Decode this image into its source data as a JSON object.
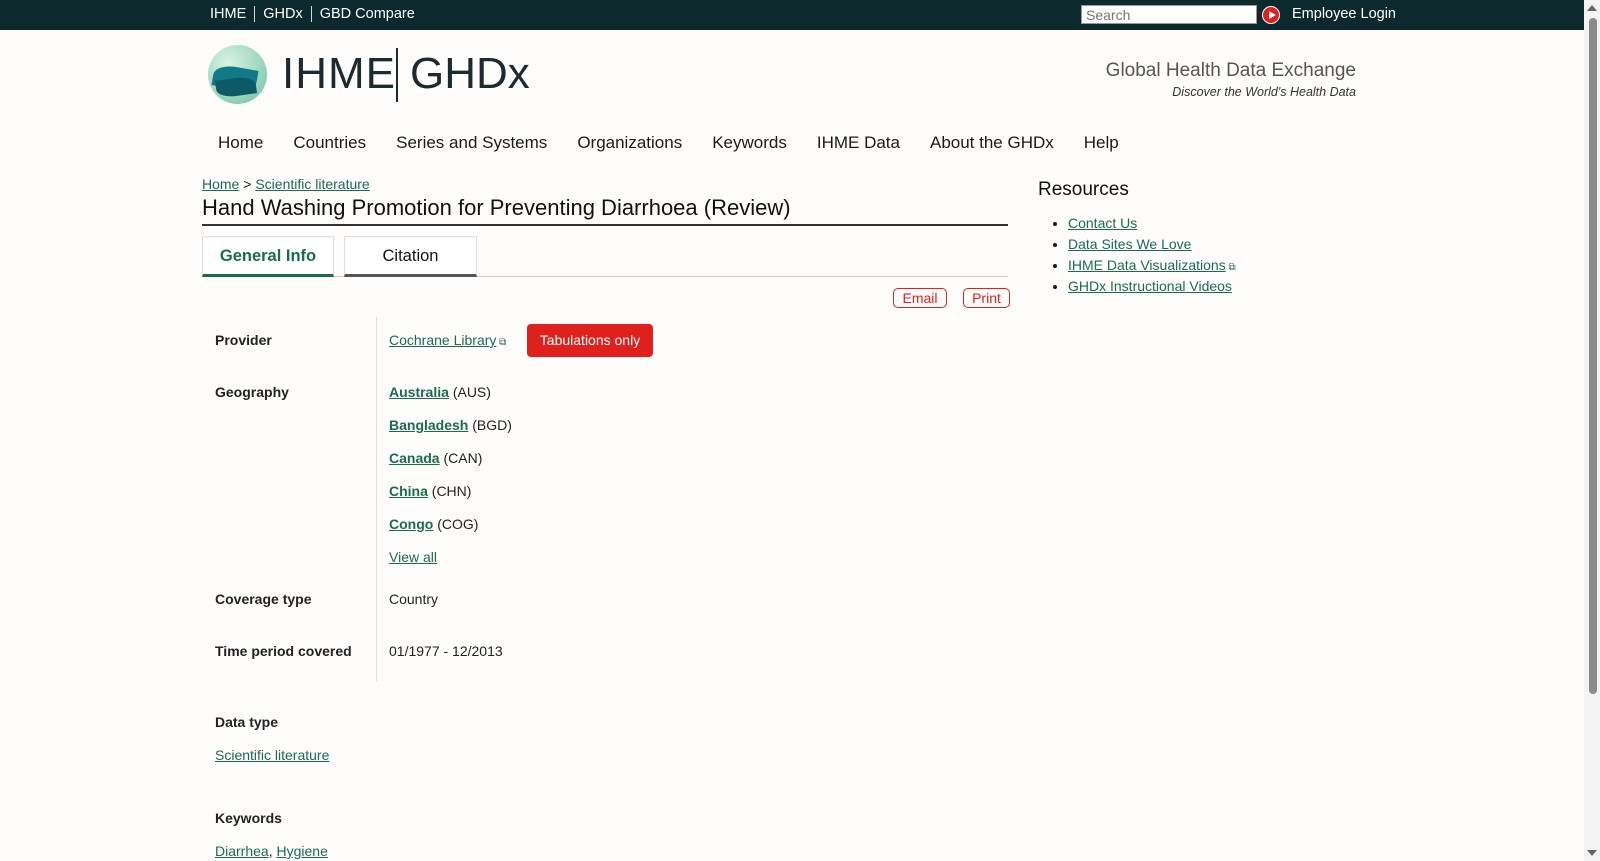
{
  "topbar": {
    "links": [
      "IHME",
      "GHDx",
      "GBD Compare"
    ],
    "search_placeholder": "Search",
    "login": "Employee Login"
  },
  "header": {
    "logo_left": "IHME",
    "logo_right": "GHDx",
    "tagline": "Global Health Data Exchange",
    "subtagline": "Discover the World's Health Data"
  },
  "nav": [
    "Home",
    "Countries",
    "Series and Systems",
    "Organizations",
    "Keywords",
    "IHME Data",
    "About the GHDx",
    "Help"
  ],
  "breadcrumb": {
    "home": "Home",
    "sep": ">",
    "current": "Scientific literature"
  },
  "page_title": "Hand Washing Promotion for Preventing Diarrhoea (Review)",
  "tabs": {
    "general": "General Info",
    "citation": "Citation"
  },
  "actions": {
    "email": "Email",
    "print": "Print"
  },
  "fields": {
    "provider_label": "Provider",
    "provider_value": "Cochrane Library",
    "provider_badge": "Tabulations only",
    "geography_label": "Geography",
    "geography": [
      {
        "name": "Australia",
        "code": "(AUS)"
      },
      {
        "name": "Bangladesh",
        "code": "(BGD)"
      },
      {
        "name": "Canada",
        "code": "(CAN)"
      },
      {
        "name": "China",
        "code": "(CHN)"
      },
      {
        "name": "Congo",
        "code": "(COG)"
      }
    ],
    "geography_view_all": "View all",
    "coverage_label": "Coverage type",
    "coverage_value": "Country",
    "time_label": "Time period covered",
    "time_value": "01/1977 - 12/2013",
    "datatype_label": "Data type",
    "datatype_value": "Scientific literature",
    "keywords_label": "Keywords",
    "keywords": [
      "Diarrhea",
      "Hygiene"
    ]
  },
  "resources": {
    "title": "Resources",
    "items": [
      "Contact Us",
      "Data Sites We Love",
      "IHME Data Visualizations",
      "GHDx Instructional Videos"
    ]
  }
}
